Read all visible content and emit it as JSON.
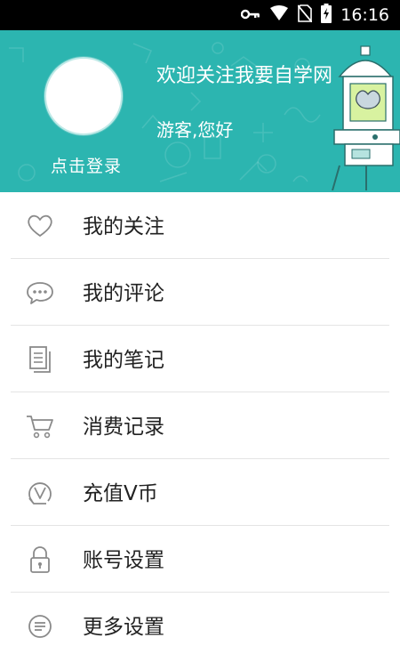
{
  "status_bar": {
    "time": "16:16",
    "icons": [
      "key-icon",
      "wifi-icon",
      "no-sim-icon",
      "battery-charging-icon"
    ]
  },
  "header": {
    "background_color": "#2cb5b0",
    "avatar_icon": "avatar-placeholder",
    "login_label": "点击登录",
    "welcome_text": "欢迎关注我要自学网",
    "greeting_text": "游客,您好"
  },
  "menu": {
    "items": [
      {
        "label": "我的关注",
        "icon": "heart-icon"
      },
      {
        "label": "我的评论",
        "icon": "comment-icon"
      },
      {
        "label": "我的笔记",
        "icon": "notes-icon"
      },
      {
        "label": "消费记录",
        "icon": "cart-icon"
      },
      {
        "label": "充值V币",
        "icon": "v-coin-icon"
      },
      {
        "label": "账号设置",
        "icon": "lock-icon"
      },
      {
        "label": "更多设置",
        "icon": "more-settings-icon"
      }
    ]
  }
}
